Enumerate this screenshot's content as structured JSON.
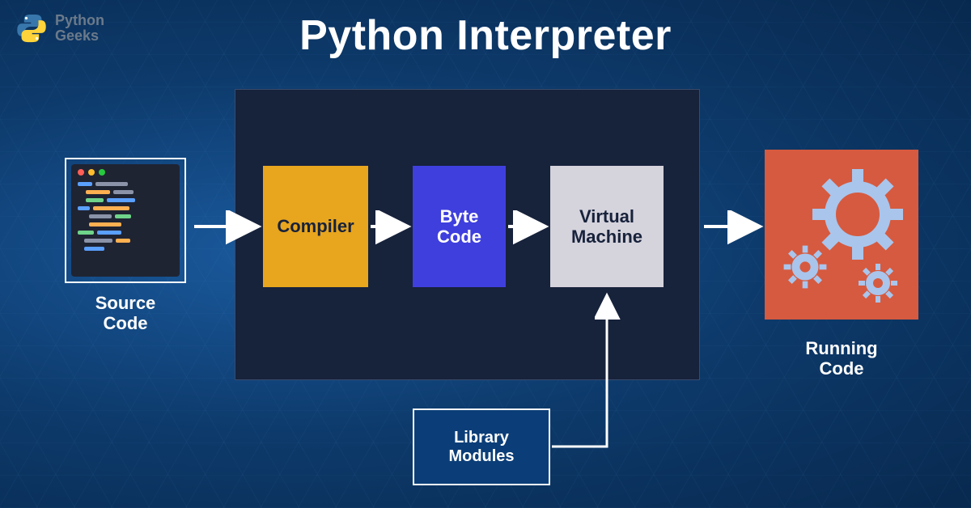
{
  "brand": {
    "name": "Python\nGeeks"
  },
  "title": "Python Interpreter",
  "nodes": {
    "source_code": "Source\nCode",
    "compiler": "Compiler",
    "byte_code": "Byte\nCode",
    "virtual_machine": "Virtual\nMachine",
    "library_modules": "Library\nModules",
    "running_code": "Running\nCode"
  },
  "colors": {
    "bg_deep": "#08294f",
    "interpreter_box": "#17223b",
    "compiler": "#e8a51e",
    "byte_code": "#3f3fde",
    "vm": "#d5d3dc",
    "library": "#0b3e78",
    "running": "#d65a3f",
    "gear": "#a9c5ec"
  }
}
